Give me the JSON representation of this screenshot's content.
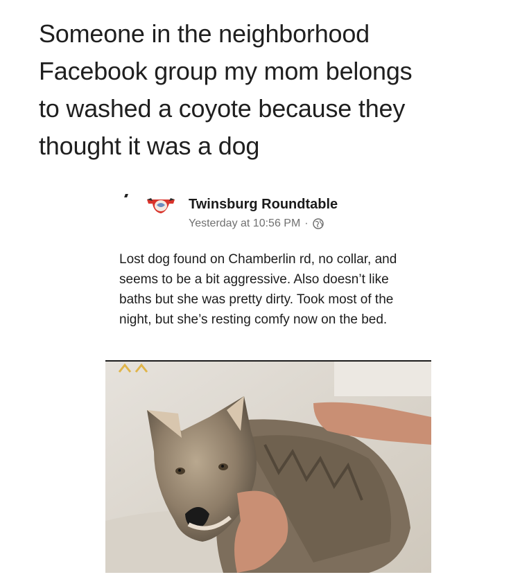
{
  "caption": {
    "line1": "Someone in the neighborhood",
    "line2": "Facebook group my mom belongs",
    "line3": "to washed a coyote because they",
    "line4": "thought it was a dog"
  },
  "post": {
    "group_name": "Twinsburg Roundtable",
    "timestamp": "Yesterday at 10:56 PM",
    "separator": "·",
    "privacy_icon": "globe-icon",
    "body": "Lost dog found on Chamberlin rd, no collar, and seems to be a bit aggressive. Also doesn’t like baths but she was pretty dirty. Took most of the night, but she’s resting comfy now on the bed.",
    "photo_subject": "coyote-being-held-by-hands"
  },
  "colors": {
    "page_bg": "#ffffff",
    "text": "#1f1f1f",
    "meta_text": "#707070",
    "photo_tint": "#c9c2b4"
  }
}
